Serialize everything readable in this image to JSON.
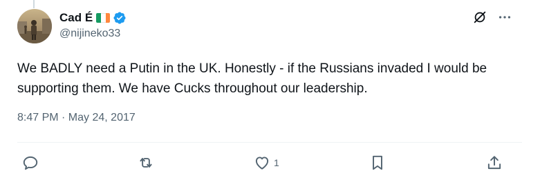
{
  "author": {
    "display_name": "Cad É",
    "handle": "@nijineko33",
    "verified": true,
    "flag_colors": [
      "#169b62",
      "#ffffff",
      "#ff883e"
    ],
    "verified_color": "#1d9bf0"
  },
  "tweet": {
    "text": "We BADLY need a Putin in the UK.  Honestly - if the Russians invaded I would be supporting them. We have Cucks throughout our leadership.",
    "timestamp": "8:47 PM · May 24, 2017"
  },
  "top_actions": {
    "grok_icon": "grok-icon",
    "more_icon": "more-icon"
  },
  "actions": {
    "reply_icon": "reply-icon",
    "retweet_icon": "retweet-icon",
    "like_icon": "heart-icon",
    "like_count": "1",
    "bookmark_icon": "bookmark-icon",
    "share_icon": "share-icon"
  },
  "colors": {
    "text": "#0f1419",
    "secondary": "#536471",
    "divider": "#eff3f4"
  }
}
